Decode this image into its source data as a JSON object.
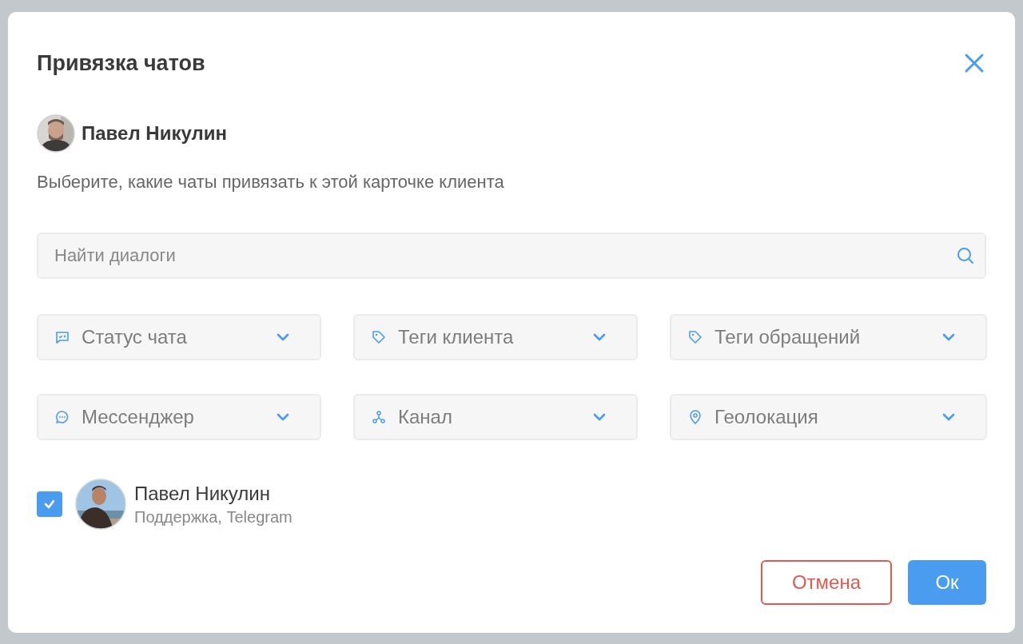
{
  "dialog": {
    "title": "Привязка чатов"
  },
  "client": {
    "name": "Павел Никулин"
  },
  "instruction": "Выберите, какие чаты привязать к этой карточке клиента",
  "search": {
    "placeholder": "Найти диалоги"
  },
  "filters": [
    {
      "kind": "status",
      "label": "Статус чата"
    },
    {
      "kind": "tag",
      "label": "Теги клиента"
    },
    {
      "kind": "tag",
      "label": "Теги обращений"
    },
    {
      "kind": "messenger",
      "label": "Мессенджер"
    },
    {
      "kind": "channel",
      "label": "Канал"
    },
    {
      "kind": "location",
      "label": "Геолокация"
    }
  ],
  "chats": [
    {
      "name": "Павел Никулин",
      "details": "Поддержка, Telegram",
      "checked": true
    }
  ],
  "buttons": [
    {
      "kind": "cancel",
      "label": "Отмена"
    },
    {
      "kind": "primary",
      "label": "Ок"
    }
  ]
}
